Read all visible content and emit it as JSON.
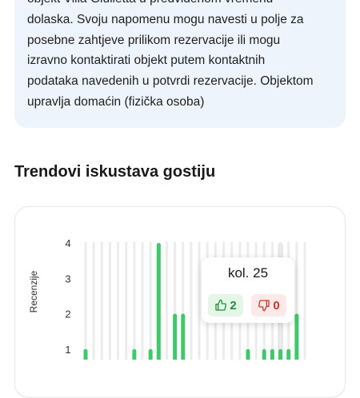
{
  "info": {
    "lines": [
      "objekt Villa Giulietta u predviđenom vremenu",
      "dolaska. Svoju napomenu mogu navesti u polje za",
      "posebne zahtjeve prilikom rezervacije ili mogu",
      "izravno kontaktirati objekt putem kontaktnih",
      "podataka navedenih u potvrdi rezervacije. Objektom",
      "upravlja domaćin (fizička osoba)"
    ]
  },
  "trends": {
    "title": "Trendovi iskustava gostiju"
  },
  "chart_data": {
    "type": "bar",
    "ylabel": "Recenzije",
    "yticks": [
      "1",
      "2",
      "3",
      "4"
    ],
    "ylim": [
      0,
      4
    ],
    "grid": true,
    "categories_visible_count": 28,
    "values": [
      1,
      0,
      0,
      0,
      0,
      0,
      1,
      0,
      1,
      4,
      0,
      2,
      2,
      0,
      0,
      0,
      0,
      0,
      0,
      0,
      1,
      0,
      1,
      1,
      1,
      1,
      2,
      0
    ],
    "highlighted_index": 24,
    "colors": {
      "bar": "#3ec96b",
      "grid": "#ececec",
      "highlight_band": "#e0e0e0"
    }
  },
  "tooltip": {
    "title": "kol. 25",
    "likes": "2",
    "dislikes": "0",
    "like_icon": "thumbs-up-icon",
    "dislike_icon": "thumbs-down-icon"
  }
}
